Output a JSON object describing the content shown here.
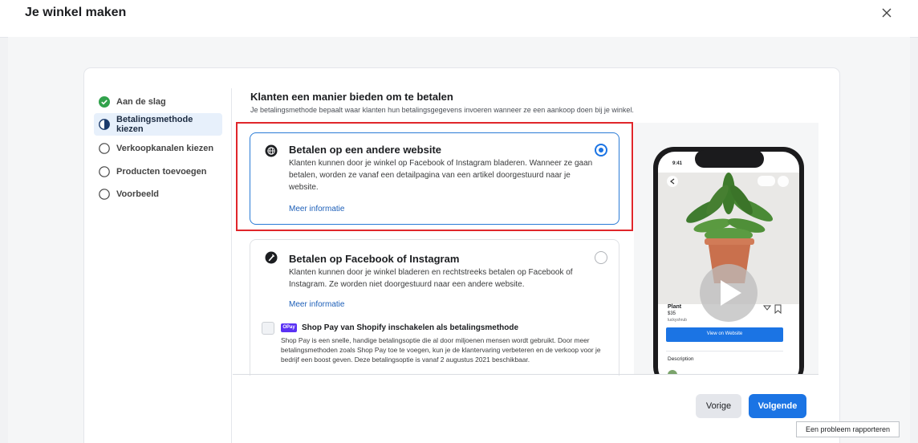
{
  "window": {
    "title": "Je winkel maken"
  },
  "steps": [
    {
      "label": "Aan de slag",
      "state": "done"
    },
    {
      "label": "Betalingsmethode kiezen",
      "state": "active"
    },
    {
      "label": "Verkoopkanalen kiezen",
      "state": "todo"
    },
    {
      "label": "Producten toevoegen",
      "state": "todo"
    },
    {
      "label": "Voorbeeld",
      "state": "todo"
    }
  ],
  "main": {
    "heading": "Klanten een manier bieden om te betalen",
    "subheading": "Je betalingsmethode bepaalt waar klanten hun betalingsgegevens invoeren wanneer ze een aankoop doen bij je winkel.",
    "options": [
      {
        "title": "Betalen op een andere website",
        "description": "Klanten kunnen door je winkel op Facebook of Instagram bladeren. Wanneer ze gaan betalen, worden ze vanaf een detailpagina van een artikel doorgestuurd naar je website.",
        "link": "Meer informatie",
        "selected": true,
        "icon": "globe-icon"
      },
      {
        "title": "Betalen op Facebook of Instagram",
        "description": "Klanten kunnen door je winkel bladeren en rechtstreeks betalen op Facebook of Instagram. Ze worden niet doorgestuurd naar een andere website.",
        "link": "Meer informatie",
        "selected": false,
        "icon": "pen-icon"
      }
    ],
    "shop_pay": {
      "badge": "OPay",
      "title": "Shop Pay van Shopify inschakelen als betalingsmethode",
      "description": "Shop Pay is een snelle, handige betalingsoptie die al door miljoenen mensen wordt gebruikt. Door meer betalingsmethoden zoals Shop Pay toe te voegen, kun je de klantervaring verbeteren en de verkoop voor je bedrijf een boost geven. Deze betalingsoptie is vanaf 2 augustus 2021 beschikbaar.",
      "checked": false
    }
  },
  "preview": {
    "time": "9:41",
    "product_name": "Plant",
    "price": "$35",
    "shop": "luckyshrub",
    "cta": "View on Website",
    "section": "Description"
  },
  "footer": {
    "prev_label": "Vorige",
    "next_label": "Volgende",
    "report_label": "Een probleem rapporteren"
  },
  "colors": {
    "accent": "#1b74e4",
    "highlight": "#e0262b",
    "success": "#31a24c"
  }
}
